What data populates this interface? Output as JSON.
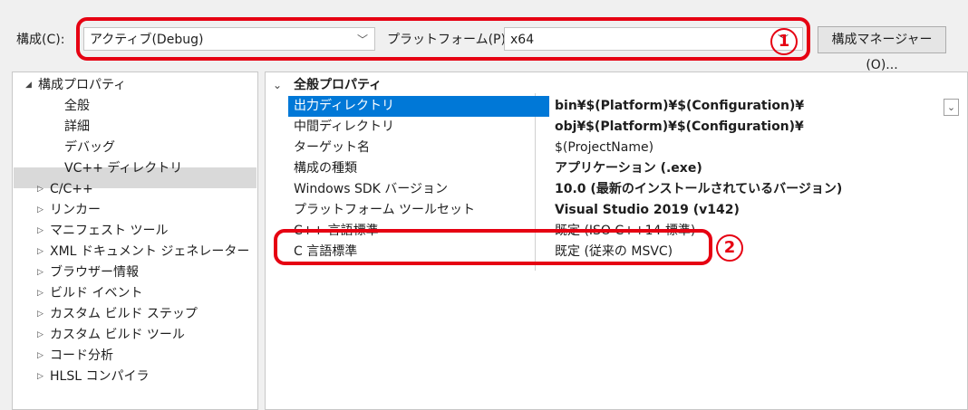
{
  "toolbar": {
    "config_label": "構成(C):",
    "config_value": "アクティブ(Debug)",
    "platform_label": "プラットフォーム(P):",
    "platform_value": "x64",
    "manager_button": "構成マネージャー(O)..."
  },
  "tree": {
    "root": "構成プロパティ",
    "items": [
      {
        "label": "全般",
        "expandable": false,
        "selected": true
      },
      {
        "label": "詳細",
        "expandable": false
      },
      {
        "label": "デバッグ",
        "expandable": false
      },
      {
        "label": "VC++ ディレクトリ",
        "expandable": false
      },
      {
        "label": "C/C++",
        "expandable": true
      },
      {
        "label": "リンカー",
        "expandable": true
      },
      {
        "label": "マニフェスト ツール",
        "expandable": true
      },
      {
        "label": "XML ドキュメント ジェネレーター",
        "expandable": true
      },
      {
        "label": "ブラウザー情報",
        "expandable": true
      },
      {
        "label": "ビルド イベント",
        "expandable": true
      },
      {
        "label": "カスタム ビルド ステップ",
        "expandable": true
      },
      {
        "label": "カスタム ビルド ツール",
        "expandable": true
      },
      {
        "label": "コード分析",
        "expandable": true
      },
      {
        "label": "HLSL コンパイラ",
        "expandable": true
      }
    ]
  },
  "grid": {
    "section": "全般プロパティ",
    "rows": [
      {
        "key": "出力ディレクトリ",
        "value": "bin¥$(Platform)¥$(Configuration)¥",
        "bold": true
      },
      {
        "key": "中間ディレクトリ",
        "value": "obj¥$(Platform)¥$(Configuration)¥",
        "bold": true
      },
      {
        "key": "ターゲット名",
        "value": "$(ProjectName)",
        "bold": false
      },
      {
        "key": "構成の種類",
        "value": "アプリケーション (.exe)",
        "bold": true
      },
      {
        "key": "Windows SDK バージョン",
        "value": "10.0 (最新のインストールされているバージョン)",
        "bold": true
      },
      {
        "key": "プラットフォーム ツールセット",
        "value": "Visual Studio 2019 (v142)",
        "bold": true
      },
      {
        "key": "C++ 言語標準",
        "value": "既定 (ISO C++14 標準)",
        "bold": false
      },
      {
        "key": "C 言語標準",
        "value": "既定 (従来の MSVC)",
        "bold": false
      }
    ]
  },
  "annotations": {
    "marker1": "1",
    "marker2": "2",
    "color": "#e60012"
  },
  "colors": {
    "selection": "#0078d7",
    "tree_selection": "#d9d9d9"
  }
}
